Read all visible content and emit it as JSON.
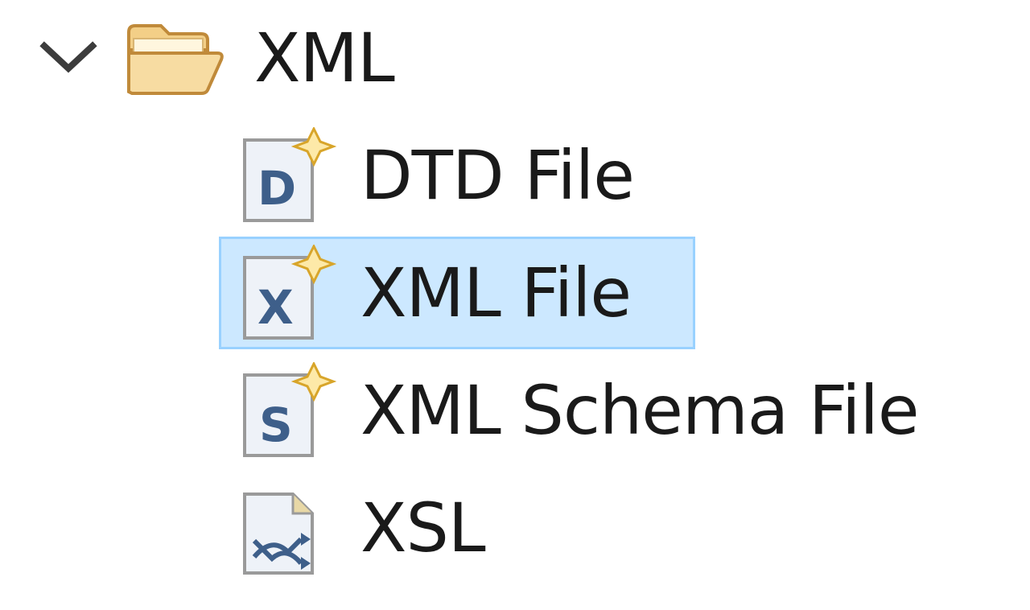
{
  "tree": {
    "folder": {
      "label": "XML",
      "expanded": true,
      "chevron_icon": "chevron-down-icon",
      "icon": "open-folder-icon"
    },
    "items": [
      {
        "label": "DTD File",
        "icon": "dtd-file-icon",
        "selected": false
      },
      {
        "label": "XML File",
        "icon": "xml-file-icon",
        "selected": true
      },
      {
        "label": "XML Schema File",
        "icon": "xml-schema-file-icon",
        "selected": false
      },
      {
        "label": "XSL",
        "icon": "xsl-file-icon",
        "selected": false
      }
    ],
    "colors": {
      "selection_fill": "#cce8ff",
      "selection_border": "#99d1ff",
      "folder": "#f5d596",
      "file_letter": "#3e5f8a",
      "new_star": "#f0c04a"
    }
  }
}
